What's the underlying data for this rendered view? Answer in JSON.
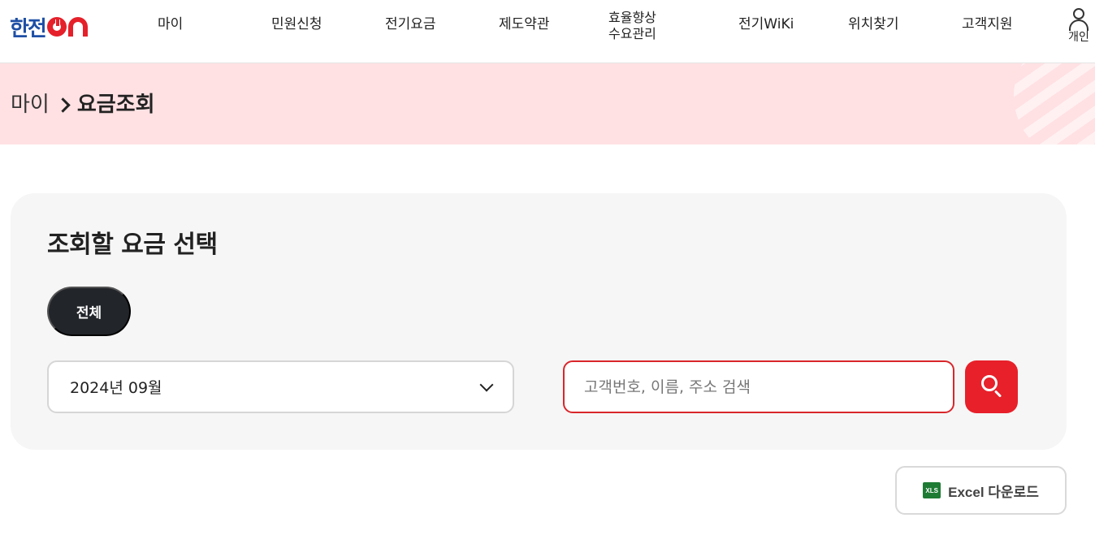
{
  "header": {
    "logo_text": "한전",
    "nav": [
      {
        "label": "마이"
      },
      {
        "label": "민원신청"
      },
      {
        "label": "전기요금"
      },
      {
        "label": "제도약관"
      },
      {
        "label_line1": "효율향상",
        "label_line2": "수요관리"
      },
      {
        "label": "전기WiKi"
      },
      {
        "label": "위치찾기"
      },
      {
        "label": "고객지원"
      }
    ],
    "user_label": "개인"
  },
  "breadcrumb": {
    "home": "마이",
    "current": "요금조회"
  },
  "panel": {
    "title": "조회할 요금 선택",
    "chip_all": "전체",
    "month_value": "2024년 09월",
    "search_placeholder": "고객번호, 이름, 주소 검색"
  },
  "excel": {
    "icon_text": "XLS",
    "label": "Excel 다운로드"
  },
  "colors": {
    "brand_blue": "#1e4fa5",
    "brand_red": "#e7202a",
    "breadcrumb_bg": "#ffe1e3",
    "panel_bg": "#f6f6f6",
    "chip_dark": "#22252a",
    "excel_green": "#1e7b34"
  },
  "icons": [
    "kepco-on-logo",
    "user-icon",
    "chevron-right-icon",
    "chevron-down-icon",
    "search-icon",
    "xls-icon"
  ]
}
